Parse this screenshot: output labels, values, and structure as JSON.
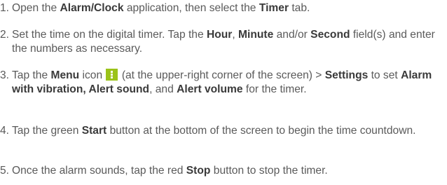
{
  "steps": [
    {
      "number": "1.",
      "parts": [
        "Open the ",
        "Alarm/Clock",
        " application, then select the ",
        "Timer",
        " tab."
      ]
    },
    {
      "number": "2.",
      "parts": [
        "Set the time on the digital timer. Tap the ",
        "Hour",
        ", ",
        "Minute",
        " and/or ",
        "Second",
        " field(s) and enter the numbers as necessary."
      ]
    },
    {
      "number": "3.",
      "parts": [
        "Tap the ",
        "Menu",
        " icon ",
        " (at the upper-right corner of the screen) > ",
        "Settings",
        " to set ",
        "Alarm with vibration, Alert sound",
        ", and ",
        "Alert volume",
        " for the timer."
      ]
    },
    {
      "number": "4.",
      "parts": [
        "Tap the green ",
        "Start",
        " button at the bottom of the screen to begin the time countdown."
      ]
    },
    {
      "number": "5.",
      "parts": [
        "Once the alarm sounds, tap the red ",
        "Stop",
        " button to stop the timer."
      ]
    }
  ],
  "icons": {
    "menu": "menu-icon"
  },
  "colors": {
    "text": "#5a5a5a",
    "bold": "#3a3a3a",
    "menu_icon": "#9bc31a"
  }
}
